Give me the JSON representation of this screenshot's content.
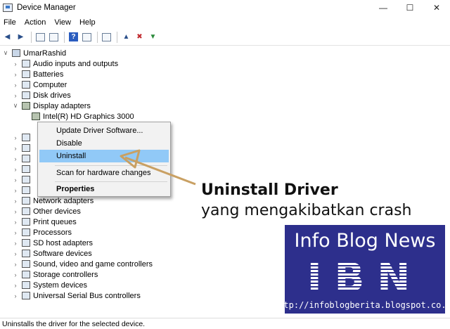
{
  "window": {
    "title": "Device Manager",
    "icon": "device-manager-icon"
  },
  "menu": [
    "File",
    "Action",
    "View",
    "Help"
  ],
  "tree": {
    "root": "UmarRashid",
    "nodes": [
      {
        "label": "Audio inputs and outputs",
        "expanded": false
      },
      {
        "label": "Batteries",
        "expanded": false
      },
      {
        "label": "Computer",
        "expanded": false
      },
      {
        "label": "Disk drives",
        "expanded": false
      },
      {
        "label": "Display adapters",
        "expanded": true
      },
      {
        "label": "Intel(R) HD Graphics 3000",
        "child": true
      },
      {
        "label": "Network adapters",
        "expanded": false
      },
      {
        "label": "Other devices",
        "expanded": false
      },
      {
        "label": "Print queues",
        "expanded": false
      },
      {
        "label": "Processors",
        "expanded": false
      },
      {
        "label": "SD host adapters",
        "expanded": false
      },
      {
        "label": "Software devices",
        "expanded": false
      },
      {
        "label": "Sound, video and game controllers",
        "expanded": false
      },
      {
        "label": "Storage controllers",
        "expanded": false
      },
      {
        "label": "System devices",
        "expanded": false
      },
      {
        "label": "Universal Serial Bus controllers",
        "expanded": false
      }
    ]
  },
  "context_menu": {
    "items": [
      {
        "label": "Update Driver Software...",
        "selected": false
      },
      {
        "label": "Disable",
        "selected": false
      },
      {
        "label": "Uninstall",
        "selected": true
      },
      {
        "label": "Scan for hardware changes",
        "selected": false
      },
      {
        "label": "Properties",
        "selected": false,
        "bold": true
      }
    ]
  },
  "annotation": {
    "line1": "Uninstall Driver",
    "line2": "yang mengakibatkan crash",
    "arrow_color": "#c9a063"
  },
  "logo": {
    "title": "Info Blog News",
    "mark": "IBN",
    "url": "http://infoblogberita.blogspot.co.id",
    "background": "#2d2f8c"
  },
  "status": "Uninstalls the driver for the selected device.",
  "colors": {
    "selection": "#91c9f7"
  }
}
